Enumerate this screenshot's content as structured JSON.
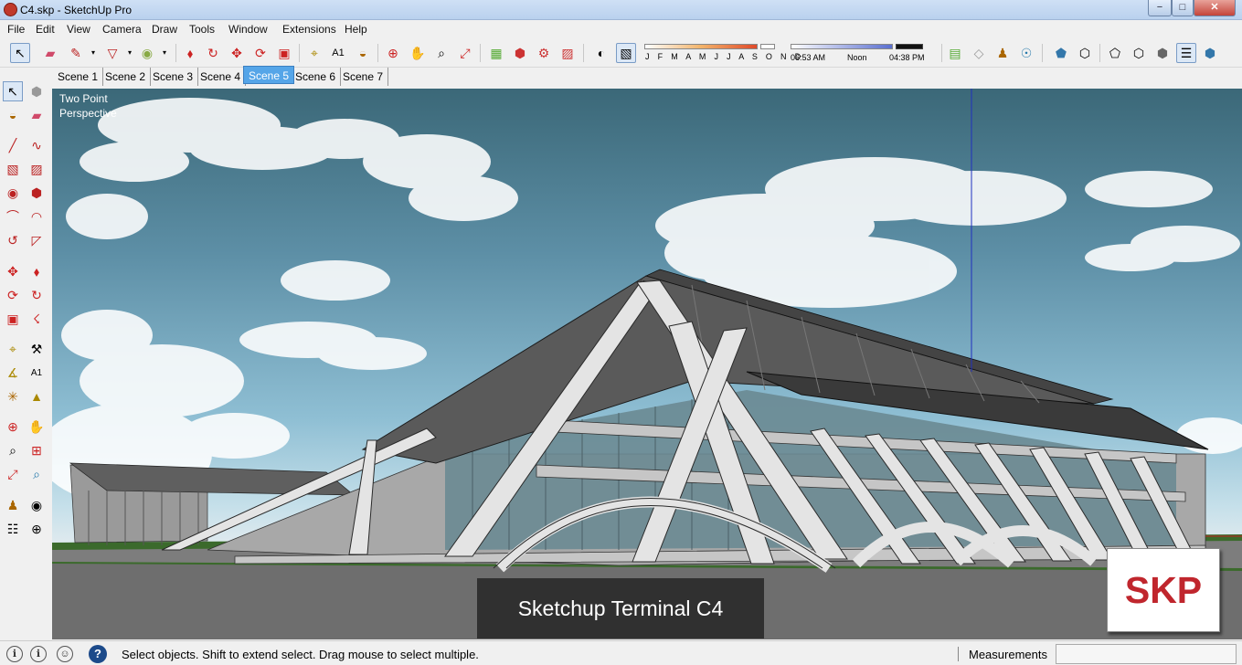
{
  "window": {
    "title": "C4.skp - SketchUp Pro",
    "min_glyph": "−",
    "max_glyph": "□",
    "close_glyph": "✕"
  },
  "menu": [
    "File",
    "Edit",
    "View",
    "Camera",
    "Draw",
    "Tools",
    "Window",
    "Extensions",
    "Help"
  ],
  "shadows": {
    "months": "J F M A M J J A S O N D",
    "time_start": "06:53 AM",
    "time_mid": "Noon",
    "time_end": "04:38 PM"
  },
  "scenes": [
    "Scene 1",
    "Scene 2",
    "Scene 3",
    "Scene 4",
    "Scene 5",
    "Scene 6",
    "Scene 7"
  ],
  "active_scene": "Scene 5",
  "viewport": {
    "mode_label": "Two Point\nPerspective",
    "caption": "Sketchup Terminal C4",
    "logo_text": "SKP"
  },
  "status": {
    "text": "Select objects. Shift to extend select. Drag mouse to select multiple.",
    "measurements_label": "Measurements",
    "measurements_value": ""
  },
  "colors": {
    "accent": "#55a5e8",
    "logo_red": "#c0262d",
    "close_red": "#c4443a"
  }
}
